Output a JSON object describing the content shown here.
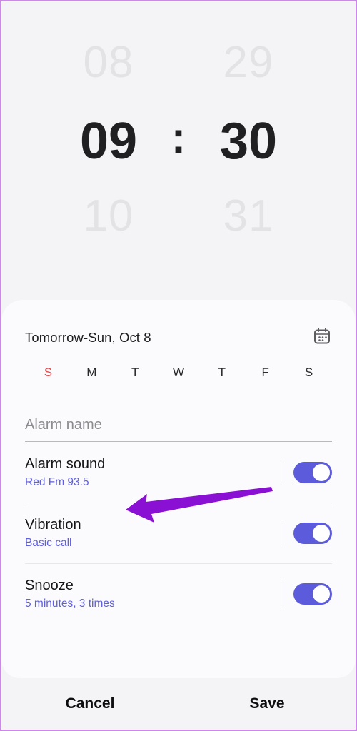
{
  "colors": {
    "screen_border": "#c98ae2",
    "page_background": "#f4f4f7",
    "sheet_background": "#fbfbfd",
    "accent_toggle": "#5b5bdb",
    "accent_subtitle": "#5f5fe0",
    "sunday_red": "#dd4b4b",
    "annotation_purple": "#8a10d4",
    "time_selected": "#202023",
    "time_faded": "#e3e3e6"
  },
  "time_picker": {
    "hour": {
      "previous": "08",
      "selected": "09",
      "next": "10"
    },
    "separator": ":",
    "minute": {
      "previous": "29",
      "selected": "30",
      "next": "31"
    }
  },
  "sheet": {
    "date": {
      "label": "Tomorrow-Sun, Oct 8",
      "calendar_icon": "calendar-icon"
    },
    "weekdays": [
      {
        "label": "S",
        "selected": true
      },
      {
        "label": "M",
        "selected": false
      },
      {
        "label": "T",
        "selected": false
      },
      {
        "label": "W",
        "selected": false
      },
      {
        "label": "T",
        "selected": false
      },
      {
        "label": "F",
        "selected": false
      },
      {
        "label": "S",
        "selected": false
      }
    ],
    "alarm_name": {
      "value": "",
      "placeholder": "Alarm name"
    },
    "settings": [
      {
        "title": "Alarm sound",
        "subtitle": "Red Fm 93.5",
        "toggle_on": true
      },
      {
        "title": "Vibration",
        "subtitle": "Basic call",
        "toggle_on": true
      },
      {
        "title": "Snooze",
        "subtitle": "5 minutes, 3 times",
        "toggle_on": true
      }
    ]
  },
  "bottom_bar": {
    "cancel_label": "Cancel",
    "save_label": "Save"
  },
  "annotation": {
    "type": "arrow",
    "direction": "left",
    "points_at": "Alarm sound"
  }
}
